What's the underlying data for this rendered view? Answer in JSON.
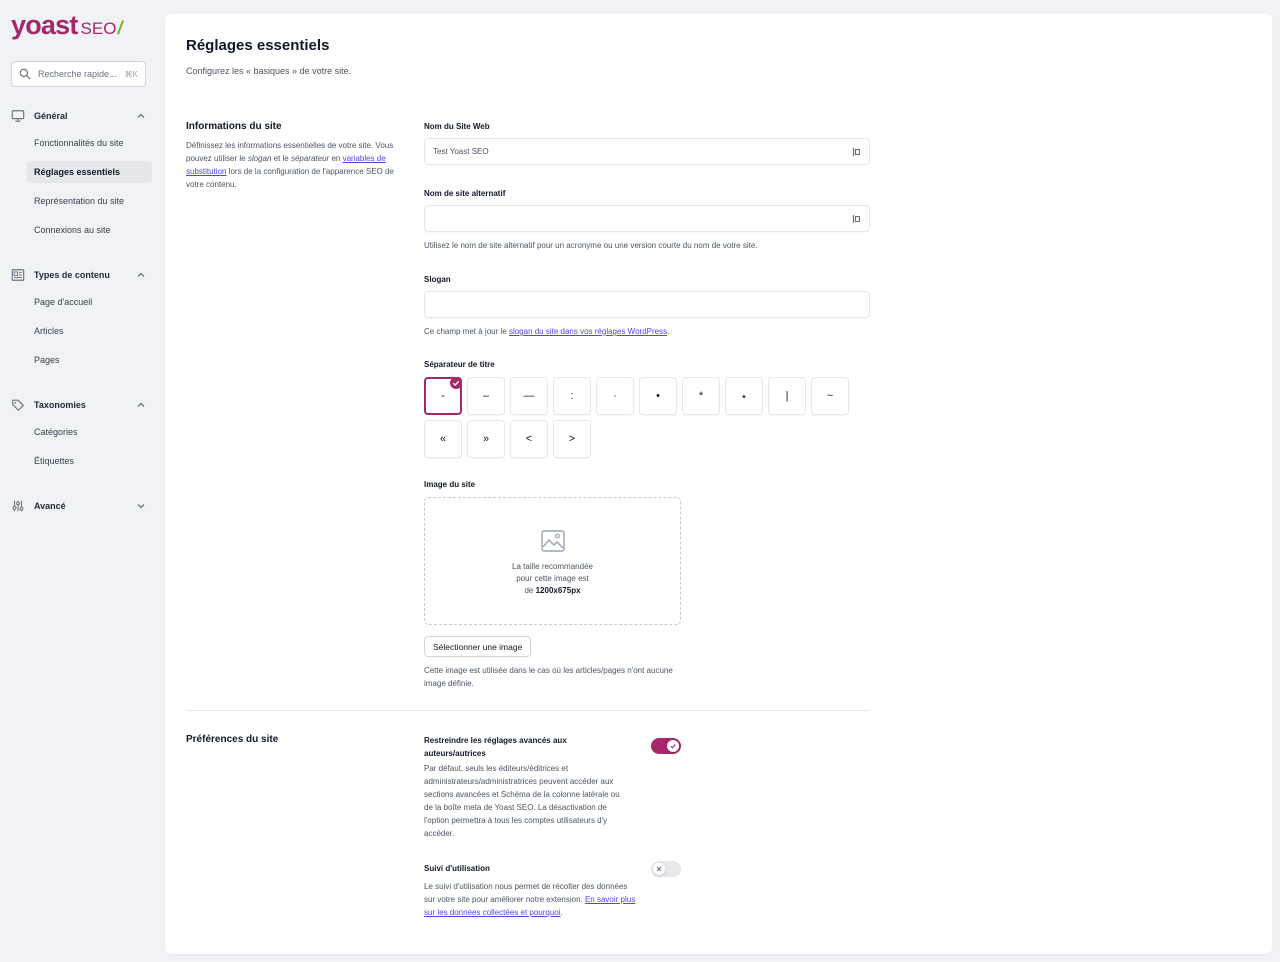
{
  "sidebar": {
    "logo_main": "yoast",
    "logo_sub": "SEO",
    "logo_slash": "/",
    "search": {
      "placeholder": "Recherche rapide...",
      "shortcut": "⌘K"
    },
    "groups": [
      {
        "label": "Général",
        "icon": "monitor-icon",
        "expanded": true,
        "items": [
          "Fonctionnalités du site",
          "Réglages essentiels",
          "Représentation du site",
          "Connexions au site"
        ]
      },
      {
        "label": "Types de contenu",
        "icon": "newspaper-icon",
        "expanded": true,
        "items": [
          "Page d'accueil",
          "Articles",
          "Pages"
        ]
      },
      {
        "label": "Taxonomies",
        "icon": "tag-icon",
        "expanded": true,
        "items": [
          "Catégories",
          "Étiquettes"
        ]
      },
      {
        "label": "Avancé",
        "icon": "sliders-icon",
        "expanded": false,
        "items": []
      }
    ],
    "active_item": "Réglages essentiels"
  },
  "main": {
    "title": "Réglages essentiels",
    "subtitle": "Configurez les « basiques » de votre site.",
    "site_info": {
      "title": "Informations du site",
      "desc_1": "Définissez les informations essentielles de votre site. Vous pouvez utiliser le ",
      "desc_slogan": "slogan",
      "desc_2": " et le ",
      "desc_separator": "séparateur",
      "desc_3": " en ",
      "desc_link": "variables de substitution",
      "desc_4": " lors de la configuration de l'apparence SEO de votre contenu."
    },
    "fields": {
      "site_name": {
        "label": "Nom du Site Web",
        "value": "Test Yoast SEO"
      },
      "alt_name": {
        "label": "Nom de site alternatif",
        "value": "",
        "help": "Utilisez le nom de site alternatif pour un acronyme ou une version courte du nom de votre site."
      },
      "slogan": {
        "label": "Slogan",
        "value": "",
        "help_pre": "Ce champ met à jour le ",
        "help_link": "slogan du site dans vos réglages WordPress",
        "help_post": "."
      }
    },
    "separator": {
      "label": "Séparateur de titre",
      "options": [
        "-",
        "–",
        "—",
        ":",
        "·",
        "•",
        "*",
        "⋆",
        "|",
        "~",
        "«",
        "»",
        "<",
        ">"
      ],
      "selected": "-"
    },
    "site_image": {
      "label": "Image du site",
      "hint_1": "La taille recommandée",
      "hint_2": "pour cette image est",
      "hint_3": "de ",
      "hint_size": "1200x675px",
      "button": "Sélectionner une image",
      "help": "Cette image est utilisée dans le cas où les articles/pages n'ont aucune image définie."
    },
    "preferences": {
      "title": "Préférences du site",
      "restrict": {
        "label": "Restreindre les réglages avancés aux auteurs/autrices",
        "desc": "Par défaut, seuls les éditeurs/éditrices et administrateurs/administratrices peuvent accéder aux sections avancées et Schéma de la colonne latérale ou de la boîte meta de Yoast SEO. La désactivation de l'option permettra à tous les comptes utilisateurs d'y accéder.",
        "enabled": true
      },
      "tracking": {
        "label": "Suivi d'utilisation",
        "desc": "Le suivi d'utilisation nous permet de récolter des données sur votre site pour améliorer notre extension. ",
        "link": "En savoir plus sur les données collectées et pourquoi",
        "post": ".",
        "enabled": false
      }
    }
  },
  "colors": {
    "brand": "#a4286a",
    "link": "#4f46e5",
    "logo_slash": "#77b227"
  }
}
